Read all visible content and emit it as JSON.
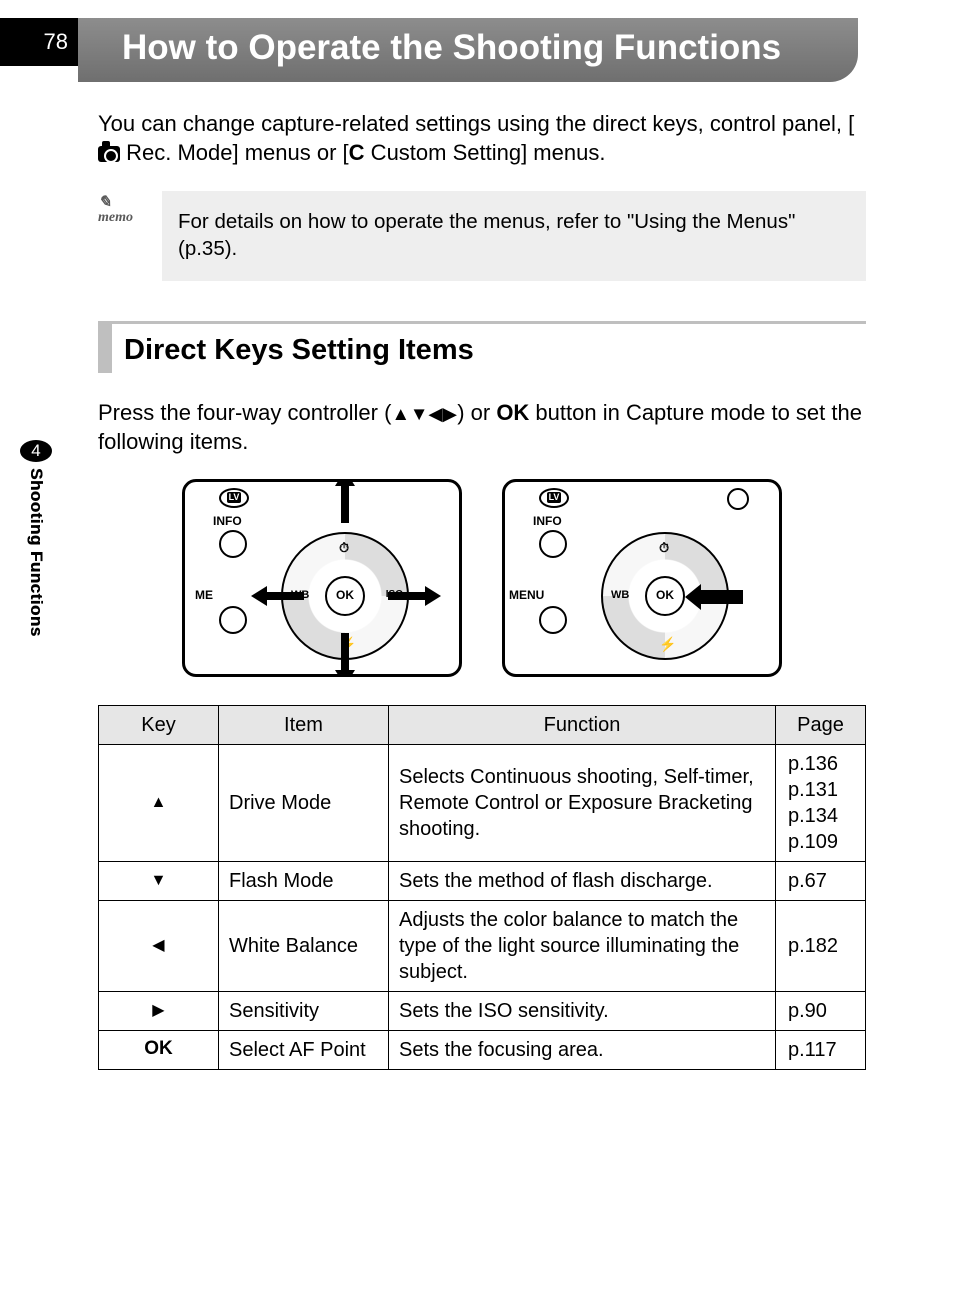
{
  "page_number": "78",
  "chapter_number": "4",
  "side_label": "Shooting Functions",
  "title": "How to Operate the Shooting Functions",
  "intro_prefix": "You can change capture-related settings using the direct keys, control panel, [",
  "intro_mid": " Rec. Mode] menus or [",
  "intro_custom_letter": "C",
  "intro_suffix": " Custom Setting] menus.",
  "memo_label": "memo",
  "memo_text": "For details on how to operate the menus, refer to \"Using the Menus\" (p.35).",
  "section_heading": "Direct Keys Setting Items",
  "press_text_a": "Press the four-way controller (",
  "press_arrows": "▲▼◀▶",
  "press_text_b": ") or ",
  "press_ok": "OK",
  "press_text_c": " button in Capture mode to set the following items.",
  "diagram": {
    "lv": "LV",
    "info": "INFO",
    "menu": "MENU",
    "menu_short": "ME",
    "wb": "WB",
    "ok": "OK",
    "iso": "ISO",
    "timer_glyph": "◌",
    "flash_glyph": "⚡"
  },
  "table": {
    "headers": {
      "key": "Key",
      "item": "Item",
      "function": "Function",
      "page": "Page"
    },
    "rows": [
      {
        "key": "▲",
        "item": "Drive Mode",
        "function": "Selects Continuous shooting, Self-timer, Remote Control or Exposure Bracketing shooting.",
        "page": "p.136\np.131\np.134\np.109"
      },
      {
        "key": "▼",
        "item": "Flash Mode",
        "function": "Sets the method of flash discharge.",
        "page": "p.67"
      },
      {
        "key": "◀",
        "item": "White Balance",
        "function": "Adjusts the color balance to match the type of the light source illuminating the subject.",
        "page": "p.182"
      },
      {
        "key": "▶",
        "item": "Sensitivity",
        "function": "Sets the ISO sensitivity.",
        "page": "p.90"
      },
      {
        "key": "OK",
        "item": "Select AF Point",
        "function": "Sets the focusing area.",
        "page": "p.117"
      }
    ]
  }
}
